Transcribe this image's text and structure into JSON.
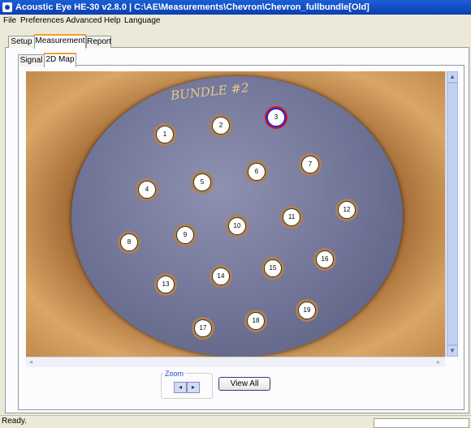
{
  "window": {
    "title": "Acoustic Eye HE-30 v2.8.0  |  C:\\AE\\Measurements\\Chevron\\Chevron_fullbundle[Old]"
  },
  "menu": [
    "File",
    "Preferences",
    "Advanced",
    "Help",
    "Language"
  ],
  "main_tabs": [
    "Setup",
    "Measurement",
    "Report"
  ],
  "sub_tabs": [
    "Signal",
    "2D Map"
  ],
  "map": {
    "label": "BUNDLE #2",
    "selected_tube": "3",
    "tubes": [
      "1",
      "2",
      "3",
      "4",
      "5",
      "6",
      "7",
      "8",
      "9",
      "10",
      "11",
      "12",
      "13",
      "14",
      "15",
      "16",
      "17",
      "18",
      "19"
    ]
  },
  "zoom": {
    "label": "Zoom",
    "left": "◂",
    "right": "▸"
  },
  "view_all_label": "View All",
  "status": "Ready."
}
